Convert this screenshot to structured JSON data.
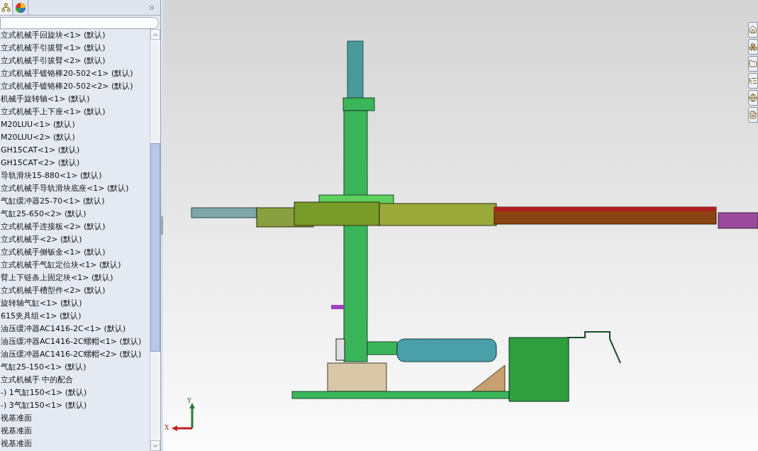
{
  "feature_tree": {
    "items": [
      "立式机械手回旋块<1> (默认)",
      "立式机械手引拔臂<1> (默认)",
      "立式机械手引拔臂<2> (默认)",
      "立式机械手镀铬棒20-502<1> (默认)",
      "立式机械手镀铬棒20-502<2> (默认)",
      "机械手旋转轴<1> (默认)",
      "立式机械手上下座<1> (默认)",
      "M20LUU<1> (默认)",
      "M20LUU<2> (默认)",
      "GH15CAT<1> (默认)",
      "GH15CAT<2> (默认)",
      "导轨滑块15-880<1> (默认)",
      "立式机械手导轨滑块底座<1> (默认)",
      "气缸缓冲器25-70<1> (默认)",
      "气缸25-650<2> (默认)",
      "立式机械手连接板<2> (默认)",
      "立式机械手<2> (默认)",
      "立式机械手侧钣金<1> (默认)",
      "立式机械手气缸定位块<1> (默认)",
      "臂上下链条上固定块<1> (默认)",
      "立式机械手槽型件<2> (默认)",
      "旋转轴气缸<1> (默认)",
      "615夹具组<1> (默认)",
      "油压缓冲器AC1416-2C<1> (默认)",
      "油压缓冲器AC1416-2C螺帽<1> (默认)",
      "油压缓冲器AC1416-2C螺帽<2> (默认)",
      "气缸25-150<1> (默认)",
      "立式机械手 中的配合",
      "-) 1气缸150<1> (默认)",
      "-) 3气缸150<1> (默认)",
      "视基准面",
      "视基准面",
      "视基准面"
    ]
  },
  "triad": {
    "y_label": "Y",
    "x_label": "X"
  }
}
